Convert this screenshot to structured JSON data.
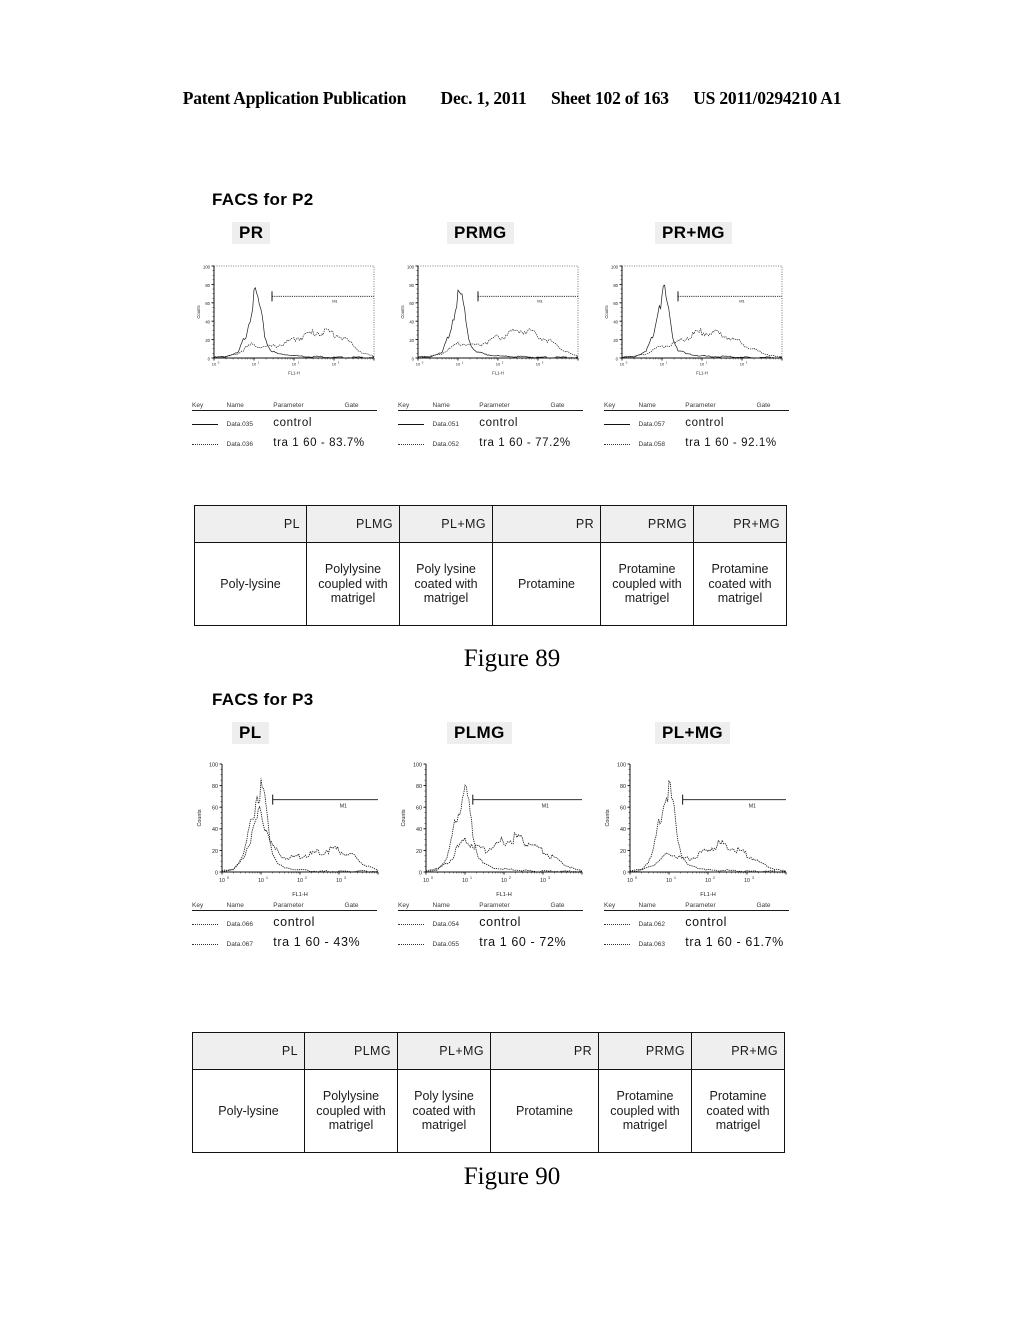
{
  "header": {
    "publication": "Patent Application Publication",
    "date": "Dec. 1, 2011",
    "sheet": "Sheet 102 of 163",
    "patent_number": "US 2011/0294210 A1"
  },
  "figures": [
    {
      "id": "fig89",
      "facs_title": "FACS for P2",
      "caption": "Figure 89",
      "panels": [
        {
          "label": "PR",
          "axis": {
            "ylabel": "Counts",
            "xlabel": "FL1-H",
            "xticks": [
              "10^0",
              "10^1",
              "10^2",
              "10^3"
            ],
            "yticks": [
              "0",
              "20",
              "40",
              "60",
              "80",
              "100"
            ],
            "ymax": 100
          },
          "gate_marker": "M1",
          "legend": {
            "columns": [
              "Key",
              "Name",
              "Parameter",
              "Gate"
            ],
            "rows": [
              {
                "key": "solid",
                "name": "Data.035",
                "parameter": "control",
                "gate": ""
              },
              {
                "key": "dotted",
                "name": "Data.036",
                "parameter": "tra 1 60 - 83.7%",
                "gate": ""
              }
            ]
          }
        },
        {
          "label": "PRMG",
          "axis": {
            "ylabel": "Counts",
            "xlabel": "FL1-H",
            "xticks": [
              "10^0",
              "10^1",
              "10^2",
              "10^3"
            ],
            "yticks": [
              "0",
              "20",
              "40",
              "60",
              "80",
              "100"
            ],
            "ymax": 100
          },
          "gate_marker": "M1",
          "legend": {
            "columns": [
              "Key",
              "Name",
              "Parameter",
              "Gate"
            ],
            "rows": [
              {
                "key": "solid",
                "name": "Data.051",
                "parameter": "control",
                "gate": ""
              },
              {
                "key": "dotted",
                "name": "Data.052",
                "parameter": "tra 1 60 - 77.2%",
                "gate": ""
              }
            ]
          }
        },
        {
          "label": "PR+MG",
          "axis": {
            "ylabel": "Counts",
            "xlabel": "FL1-H",
            "xticks": [
              "10^0",
              "10^1",
              "10^2",
              "10^3"
            ],
            "yticks": [
              "0",
              "20",
              "40",
              "60",
              "80",
              "100"
            ],
            "ymax": 100
          },
          "gate_marker": "M1",
          "legend": {
            "columns": [
              "Key",
              "Name",
              "Parameter",
              "Gate"
            ],
            "rows": [
              {
                "key": "solid",
                "name": "Data.057",
                "parameter": "control",
                "gate": ""
              },
              {
                "key": "dotted",
                "name": "Data.058",
                "parameter": "tra 1 60 - 92.1%",
                "gate": ""
              }
            ]
          }
        }
      ],
      "table": {
        "headers": [
          "PL",
          "PLMG",
          "PL+MG",
          "PR",
          "PRMG",
          "PR+MG"
        ],
        "descriptions": [
          "Poly-lysine",
          "Polylysine coupled with matrigel",
          "Poly lysine coated with matrigel",
          "Protamine",
          "Protamine coupled with matrigel",
          "Protamine coated with matrigel"
        ]
      }
    },
    {
      "id": "fig90",
      "facs_title": "FACS for P3",
      "caption": "Figure 90",
      "panels": [
        {
          "label": "PL",
          "axis": {
            "ylabel": "Counts",
            "xlabel": "FL1-H",
            "xticks": [
              "10^0",
              "10^1",
              "10^2",
              "10^3"
            ],
            "yticks": [
              "0",
              "20",
              "40",
              "60",
              "80",
              "100"
            ],
            "ymax": 100
          },
          "gate_marker": "M1",
          "legend": {
            "columns": [
              "Key",
              "Name",
              "Parameter",
              "Gate"
            ],
            "rows": [
              {
                "key": "dotted",
                "name": "Data.066",
                "parameter": "control",
                "gate": ""
              },
              {
                "key": "dotted",
                "name": "Data.067",
                "parameter": "tra 1 60 - 43%",
                "gate": ""
              }
            ]
          }
        },
        {
          "label": "PLMG",
          "axis": {
            "ylabel": "Counts",
            "xlabel": "FL1-H",
            "xticks": [
              "10^0",
              "10^1",
              "10^2",
              "10^3"
            ],
            "yticks": [
              "0",
              "20",
              "40",
              "60",
              "80",
              "100"
            ],
            "ymax": 100
          },
          "gate_marker": "M1",
          "legend": {
            "columns": [
              "Key",
              "Name",
              "Parameter",
              "Gate"
            ],
            "rows": [
              {
                "key": "dotted",
                "name": "Data.054",
                "parameter": "control",
                "gate": ""
              },
              {
                "key": "dotted",
                "name": "Data.055",
                "parameter": "tra 1 60 - 72%",
                "gate": ""
              }
            ]
          }
        },
        {
          "label": "PL+MG",
          "axis": {
            "ylabel": "Counts",
            "xlabel": "FL1-H",
            "xticks": [
              "10^0",
              "10^1",
              "10^2",
              "10^3"
            ],
            "yticks": [
              "0",
              "20",
              "40",
              "60",
              "80",
              "100"
            ],
            "ymax": 100
          },
          "gate_marker": "M1",
          "legend": {
            "columns": [
              "Key",
              "Name",
              "Parameter",
              "Gate"
            ],
            "rows": [
              {
                "key": "dotted",
                "name": "Data.062",
                "parameter": "control",
                "gate": ""
              },
              {
                "key": "dotted",
                "name": "Data.063",
                "parameter": "tra 1 60 - 61.7%",
                "gate": ""
              }
            ]
          }
        }
      ],
      "table": {
        "headers": [
          "PL",
          "PLMG",
          "PL+MG",
          "PR",
          "PRMG",
          "PR+MG"
        ],
        "descriptions": [
          "Poly-lysine",
          "Polylysine coupled with matrigel",
          "Poly lysine coated with matrigel",
          "Protamine",
          "Protamine coupled with matrigel",
          "Protamine coated with matrigel"
        ]
      }
    }
  ],
  "chart_data": [
    {
      "type": "line",
      "title": "FACS for P2 - PR",
      "xlabel": "FL1-H",
      "ylabel": "Counts",
      "xlim": [
        0,
        4
      ],
      "ylim": [
        0,
        100
      ],
      "gate": {
        "name": "M1",
        "start": 1.45,
        "end": 4.0
      },
      "series": [
        {
          "name": "control",
          "style": "solid",
          "x": [
            0.0,
            0.3,
            0.6,
            0.8,
            0.95,
            1.05,
            1.15,
            1.25,
            1.35,
            1.45,
            1.6,
            1.8,
            2.0,
            2.3,
            2.6,
            3.0,
            3.4,
            3.8,
            4.0
          ],
          "y": [
            1,
            2,
            6,
            28,
            62,
            76,
            58,
            30,
            14,
            8,
            5,
            4,
            3,
            2,
            2,
            1,
            1,
            1,
            1
          ]
        },
        {
          "name": "tra 1 60 - 83.7%",
          "style": "dotted",
          "x": [
            0.0,
            0.3,
            0.6,
            0.8,
            0.95,
            1.1,
            1.3,
            1.5,
            1.7,
            1.9,
            2.1,
            2.3,
            2.5,
            2.7,
            2.9,
            3.1,
            3.3,
            3.5,
            3.7,
            4.0
          ],
          "y": [
            1,
            2,
            5,
            12,
            16,
            14,
            13,
            14,
            16,
            20,
            24,
            27,
            30,
            31,
            30,
            27,
            22,
            14,
            6,
            2
          ]
        }
      ]
    },
    {
      "type": "line",
      "title": "FACS for P2 - PRMG",
      "xlabel": "FL1-H",
      "ylabel": "Counts",
      "xlim": [
        0,
        4
      ],
      "ylim": [
        0,
        100
      ],
      "gate": {
        "name": "M1",
        "start": 1.5,
        "end": 4.0
      },
      "series": [
        {
          "name": "control",
          "style": "solid",
          "x": [
            0.0,
            0.3,
            0.6,
            0.8,
            0.95,
            1.05,
            1.15,
            1.25,
            1.35,
            1.5,
            1.7,
            1.9,
            2.2,
            2.6,
            3.0,
            3.4,
            3.8,
            4.0
          ],
          "y": [
            1,
            2,
            6,
            30,
            64,
            74,
            56,
            28,
            13,
            7,
            4,
            3,
            2,
            2,
            1,
            1,
            1,
            1
          ]
        },
        {
          "name": "tra 1 60 - 77.2%",
          "style": "dotted",
          "x": [
            0.0,
            0.3,
            0.6,
            0.85,
            1.0,
            1.2,
            1.4,
            1.6,
            1.8,
            2.0,
            2.2,
            2.4,
            2.6,
            2.8,
            3.0,
            3.2,
            3.5,
            3.8,
            4.0
          ],
          "y": [
            1,
            2,
            5,
            13,
            18,
            16,
            15,
            17,
            20,
            24,
            28,
            31,
            33,
            31,
            27,
            22,
            14,
            5,
            2
          ]
        }
      ]
    },
    {
      "type": "line",
      "title": "FACS for P2 - PR+MG",
      "xlabel": "FL1-H",
      "ylabel": "Counts",
      "xlim": [
        0,
        4
      ],
      "ylim": [
        0,
        100
      ],
      "gate": {
        "name": "M1",
        "start": 1.4,
        "end": 4.0
      },
      "series": [
        {
          "name": "control",
          "style": "solid",
          "x": [
            0.0,
            0.3,
            0.6,
            0.8,
            0.95,
            1.05,
            1.15,
            1.25,
            1.4,
            1.6,
            1.9,
            2.2,
            2.6,
            3.0,
            3.4,
            3.8,
            4.0
          ],
          "y": [
            1,
            2,
            7,
            32,
            66,
            78,
            58,
            26,
            10,
            5,
            3,
            2,
            2,
            1,
            1,
            1,
            1
          ]
        },
        {
          "name": "tra 1 60 - 92.1%",
          "style": "dotted",
          "x": [
            0.0,
            0.3,
            0.6,
            0.85,
            1.05,
            1.25,
            1.45,
            1.65,
            1.85,
            2.05,
            2.25,
            2.45,
            2.65,
            2.9,
            3.1,
            3.4,
            3.7,
            4.0
          ],
          "y": [
            1,
            2,
            5,
            11,
            14,
            16,
            20,
            25,
            29,
            31,
            30,
            28,
            25,
            20,
            14,
            8,
            3,
            1
          ]
        }
      ]
    },
    {
      "type": "line",
      "title": "FACS for P3 - PL",
      "xlabel": "FL1-H",
      "ylabel": "Counts",
      "xlim": [
        0,
        4
      ],
      "ylim": [
        0,
        100
      ],
      "gate": {
        "name": "M1",
        "start": 1.3,
        "end": 4.0
      },
      "series": [
        {
          "name": "control",
          "style": "dotted",
          "x": [
            0.0,
            0.3,
            0.55,
            0.75,
            0.9,
            1.0,
            1.1,
            1.2,
            1.3,
            1.45,
            1.6,
            1.8,
            2.1,
            2.5,
            3.0,
            3.5,
            4.0
          ],
          "y": [
            1,
            3,
            16,
            52,
            78,
            88,
            70,
            40,
            18,
            8,
            4,
            3,
            2,
            1,
            1,
            1,
            1
          ]
        },
        {
          "name": "tra 1 60 - 43%",
          "style": "dotted",
          "x": [
            0.0,
            0.3,
            0.55,
            0.8,
            0.95,
            1.1,
            1.3,
            1.5,
            1.7,
            1.9,
            2.1,
            2.3,
            2.5,
            2.7,
            2.9,
            3.1,
            3.4,
            3.7,
            4.0
          ],
          "y": [
            1,
            3,
            14,
            42,
            58,
            48,
            26,
            16,
            14,
            15,
            17,
            18,
            20,
            22,
            23,
            21,
            15,
            6,
            2
          ]
        }
      ]
    },
    {
      "type": "line",
      "title": "FACS for P3 - PLMG",
      "xlabel": "FL1-H",
      "ylabel": "Counts",
      "xlim": [
        0,
        4
      ],
      "ylim": [
        0,
        100
      ],
      "gate": {
        "name": "M1",
        "start": 1.2,
        "end": 4.0
      },
      "series": [
        {
          "name": "control",
          "style": "dotted",
          "x": [
            0.0,
            0.3,
            0.55,
            0.75,
            0.9,
            1.0,
            1.1,
            1.2,
            1.35,
            1.5,
            1.7,
            2.0,
            2.4,
            2.9,
            3.4,
            4.0
          ],
          "y": [
            1,
            3,
            14,
            48,
            74,
            84,
            66,
            36,
            16,
            8,
            4,
            3,
            2,
            1,
            1,
            1
          ]
        },
        {
          "name": "tra 1 60 - 72%",
          "style": "dotted",
          "x": [
            0.0,
            0.3,
            0.6,
            0.85,
            1.05,
            1.25,
            1.45,
            1.65,
            1.85,
            2.05,
            2.25,
            2.45,
            2.7,
            2.95,
            3.2,
            3.5,
            3.8,
            4.0
          ],
          "y": [
            1,
            3,
            10,
            26,
            32,
            26,
            22,
            24,
            28,
            32,
            34,
            32,
            28,
            22,
            16,
            9,
            3,
            1
          ]
        }
      ]
    },
    {
      "type": "line",
      "title": "FACS for P3 - PL+MG",
      "xlabel": "FL1-H",
      "ylabel": "Counts",
      "xlim": [
        0,
        4
      ],
      "ylim": [
        0,
        100
      ],
      "gate": {
        "name": "M1",
        "start": 1.35,
        "end": 4.0
      },
      "series": [
        {
          "name": "control",
          "style": "dotted",
          "x": [
            0.0,
            0.3,
            0.55,
            0.75,
            0.9,
            1.0,
            1.1,
            1.2,
            1.35,
            1.5,
            1.75,
            2.1,
            2.5,
            3.0,
            3.5,
            4.0
          ],
          "y": [
            1,
            3,
            14,
            50,
            76,
            86,
            68,
            38,
            16,
            7,
            4,
            2,
            2,
            1,
            1,
            1
          ]
        },
        {
          "name": "tra 1 60 - 61.7%",
          "style": "dotted",
          "x": [
            0.0,
            0.3,
            0.6,
            0.9,
            1.1,
            1.3,
            1.5,
            1.7,
            1.9,
            2.1,
            2.3,
            2.5,
            2.7,
            2.9,
            3.1,
            3.4,
            3.7,
            4.0
          ],
          "y": [
            1,
            2,
            7,
            16,
            18,
            14,
            13,
            16,
            20,
            25,
            28,
            27,
            24,
            20,
            15,
            8,
            3,
            1
          ]
        }
      ]
    }
  ]
}
